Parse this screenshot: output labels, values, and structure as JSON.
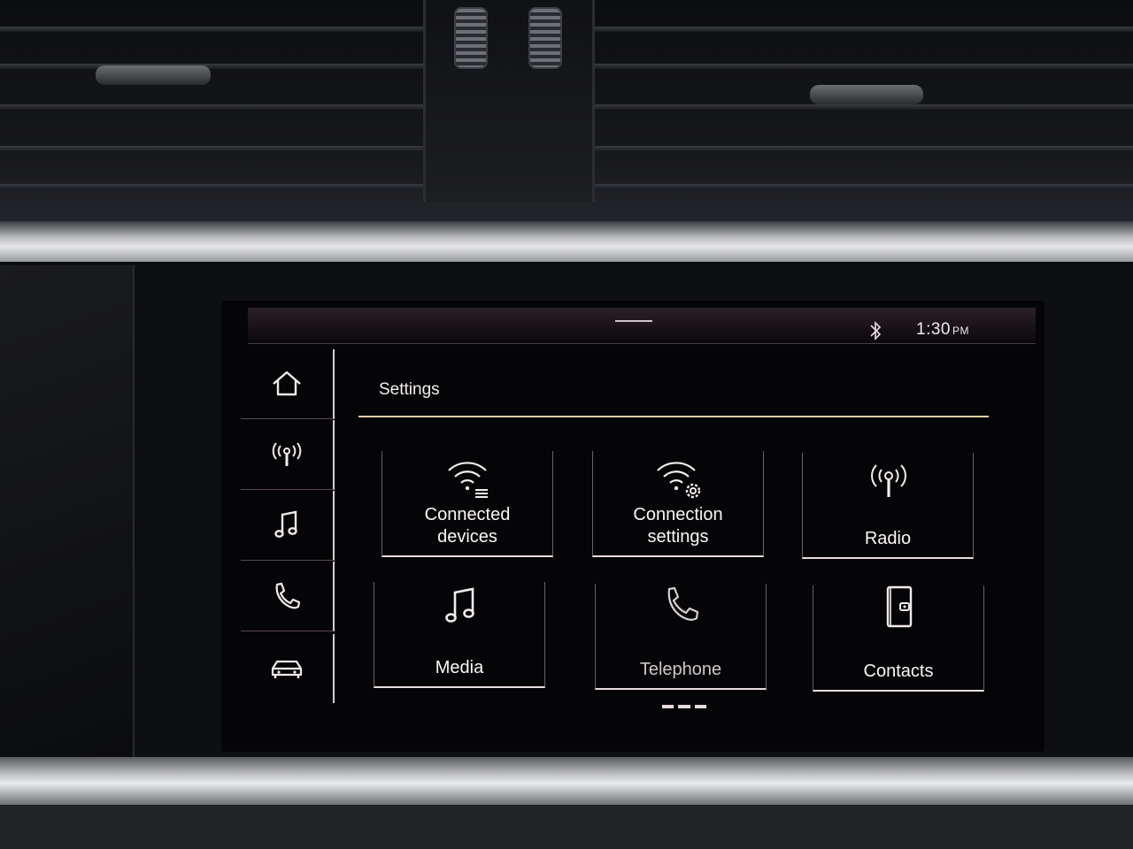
{
  "status_bar": {
    "bluetooth_icon": "bluetooth-icon",
    "time": "1:30",
    "ampm": "PM"
  },
  "side_nav": {
    "items": [
      {
        "name": "home",
        "icon": "home-icon"
      },
      {
        "name": "radio",
        "icon": "radio-antenna-icon"
      },
      {
        "name": "media",
        "icon": "music-note-icon"
      },
      {
        "name": "telephone",
        "icon": "phone-icon"
      },
      {
        "name": "car",
        "icon": "car-icon"
      }
    ]
  },
  "header": {
    "title": "Settings"
  },
  "tiles": [
    {
      "line1": "Connected",
      "line2": "devices",
      "icon": "wifi-devices-icon"
    },
    {
      "line1": "Connection",
      "line2": "settings",
      "icon": "wifi-gear-icon"
    },
    {
      "line1": "Radio",
      "line2": "",
      "icon": "radio-antenna-icon"
    },
    {
      "line1": "Media",
      "line2": "",
      "icon": "music-note-icon"
    },
    {
      "line1": "Telephone",
      "line2": "",
      "icon": "phone-icon"
    },
    {
      "line1": "Contacts",
      "line2": "",
      "icon": "contacts-book-icon"
    }
  ],
  "colors": {
    "accent_line": "#e3cfa7",
    "screen_background": "#050507",
    "text": "#fbf6f8"
  }
}
